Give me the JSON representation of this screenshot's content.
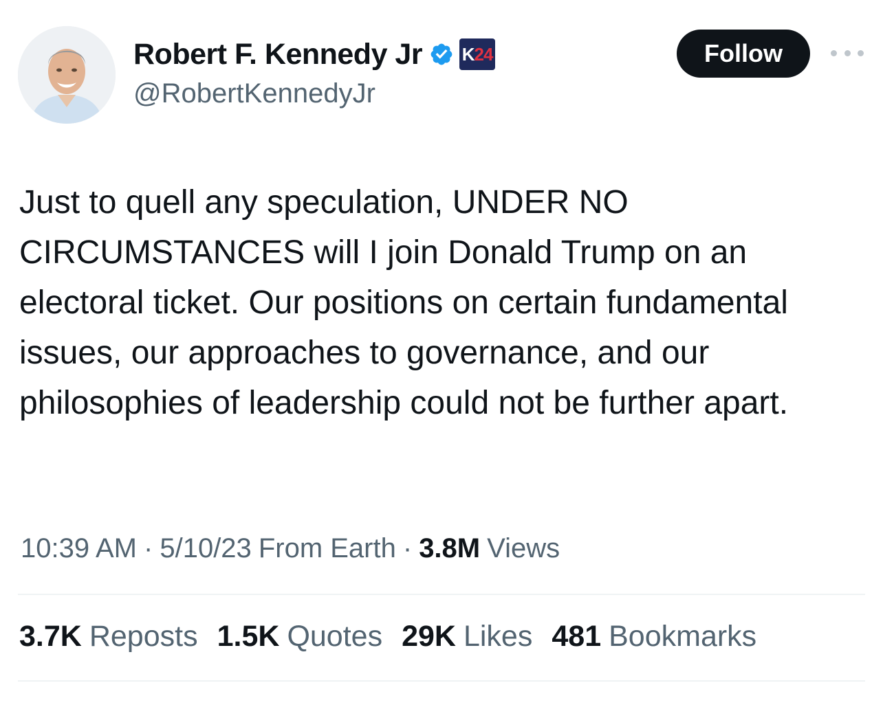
{
  "author": {
    "display_name": "Robert F. Kennedy Jr",
    "handle": "@RobertKennedyJr",
    "badge_text_letter": "K",
    "badge_text_number": "24",
    "verified_color": "#1d9bf0"
  },
  "follow_button_label": "Follow",
  "tweet": {
    "text": "Just to quell any speculation, UNDER NO CIRCUMSTANCES will I join Donald Trump on an electoral ticket. Our positions on certain fundamental issues, our approaches to governance, and our philosophies of leadership could not be further apart."
  },
  "meta": {
    "time": "10:39 AM",
    "separator": "·",
    "date": "5/10/23",
    "source": "From Earth",
    "views_count": "3.8M",
    "views_label": "Views"
  },
  "stats": [
    {
      "count": "3.7K",
      "label": "Reposts"
    },
    {
      "count": "1.5K",
      "label": "Quotes"
    },
    {
      "count": "29K",
      "label": "Likes"
    },
    {
      "count": "481",
      "label": "Bookmarks"
    }
  ],
  "colors": {
    "text_primary": "#0f1419",
    "text_secondary": "#536471",
    "follow_bg": "#0f1419",
    "badge_bg": "#1f2a5c",
    "badge_accent": "#e03141"
  }
}
